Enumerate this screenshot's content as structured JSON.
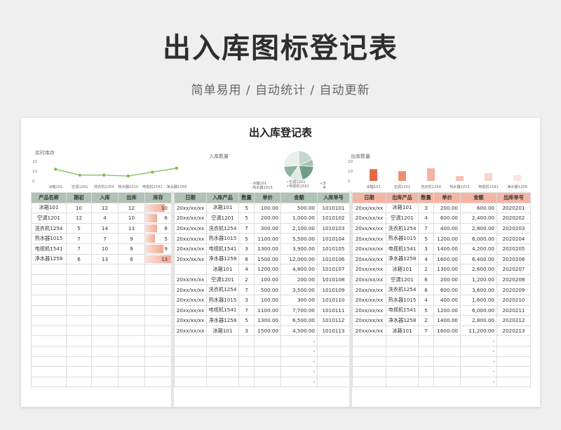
{
  "hero": {
    "title": "出入库图标登记表",
    "subtitle": "简单易用 / 自动统计 / 自动更新"
  },
  "sheet_title": "出入库登记表",
  "colors": {
    "green": "#aec3b5",
    "salmon": "#f3b6a4",
    "line": "#7cbf5a"
  },
  "charts": {
    "stock": {
      "label": "实时库存",
      "type": "line",
      "categories": [
        "冰箱101",
        "空调1201",
        "洗衣机1254",
        "热水器1015",
        "电视机1541",
        "净水器1258"
      ],
      "values": [
        12,
        6,
        6,
        5,
        9,
        13
      ],
      "yticks": [
        "20",
        "10",
        "0"
      ],
      "ylim": [
        0,
        20
      ]
    },
    "inbound": {
      "label": "入库数量",
      "type": "pie",
      "categories": [
        "冰箱101",
        "空调1201",
        "洗衣机1254",
        "热水器1015",
        "电视机1541",
        "净水器1258"
      ],
      "values": [
        9,
        4,
        10,
        7,
        7,
        13
      ],
      "colors": [
        "#c5d6cc",
        "#a9c1b3",
        "#6f9e88",
        "#dfe8e2",
        "#8fb09f",
        "#e9f0ec"
      ]
    },
    "outbound": {
      "label": "出库数量",
      "type": "bar",
      "categories": [
        "冰箱101",
        "空调1201",
        "洗衣机1254",
        "热水器1015",
        "电视机1541",
        "净水器1258"
      ],
      "values": [
        12,
        10,
        13,
        5,
        8,
        6
      ],
      "yticks": [
        "20",
        "10",
        "0"
      ],
      "ylim": [
        0,
        20
      ],
      "colors": [
        "#e26a4c",
        "#ec8f78",
        "#f2b3a3",
        "#f5c3b6",
        "#f8d4cb",
        "#fbe4de"
      ]
    }
  },
  "summary": {
    "headers": [
      "产品名称",
      "期初",
      "入库",
      "出库",
      "库存"
    ],
    "rows": [
      [
        "冰箱101",
        "10",
        "12",
        "12",
        "10"
      ],
      [
        "空调1201",
        "12",
        "4",
        "10",
        "6"
      ],
      [
        "洗衣机1254",
        "5",
        "14",
        "13",
        "6"
      ],
      [
        "热水器1015",
        "7",
        "7",
        "9",
        "5"
      ],
      [
        "电视机1541",
        "7",
        "10",
        "8",
        "9"
      ],
      [
        "净水器1258",
        "6",
        "13",
        "6",
        "13"
      ]
    ],
    "stock_levels": [
      10,
      6,
      6,
      5,
      9,
      13
    ],
    "stock_max": 13
  },
  "inbound_table": {
    "headers": [
      "日期",
      "入库产品",
      "数量",
      "单价",
      "金额",
      "入库单号"
    ],
    "rows": [
      [
        "20xx/xx/xx",
        "冰箱101",
        "5",
        "100.00",
        "500.00",
        "1010101"
      ],
      [
        "20xx/xx/xx",
        "空调1201",
        "5",
        "200.00",
        "1,000.00",
        "1010102"
      ],
      [
        "20xx/xx/xx",
        "洗衣机1254",
        "7",
        "300.00",
        "2,100.00",
        "1010103"
      ],
      [
        "20xx/xx/xx",
        "热水器1015",
        "5",
        "1100.00",
        "5,500.00",
        "1010104"
      ],
      [
        "20xx/xx/xx",
        "电视机1541",
        "3",
        "1300.00",
        "3,900.00",
        "1010105"
      ],
      [
        "20xx/xx/xx",
        "净水器1258",
        "8",
        "1500.00",
        "12,000.00",
        "1010106"
      ],
      [
        "",
        "冰箱101",
        "4",
        "1200.00",
        "4,800.00",
        "1010107"
      ],
      [
        "20xx/xx/xx",
        "空调1201",
        "2",
        "100.00",
        "200.00",
        "1010108"
      ],
      [
        "20xx/xx/xx",
        "洗衣机1254",
        "7",
        "500.00",
        "3,500.00",
        "1010109"
      ],
      [
        "20xx/xx/xx",
        "热水器1015",
        "3",
        "100.00",
        "300.00",
        "1010110"
      ],
      [
        "20xx/xx/xx",
        "电视机1541",
        "7",
        "1100.00",
        "7,700.00",
        "1010111"
      ],
      [
        "20xx/xx/xx",
        "净水器1258",
        "5",
        "1300.00",
        "6,500.00",
        "1010112"
      ],
      [
        "20xx/xx/xx",
        "冰箱101",
        "3",
        "1500.00",
        "4,500.00",
        "1010113"
      ]
    ],
    "empty_amount": "-"
  },
  "outbound_table": {
    "headers": [
      "日期",
      "出库产品",
      "数量",
      "单价",
      "金额",
      "出库单号"
    ],
    "rows": [
      [
        "20xx/xx/xx",
        "冰箱101",
        "3",
        "200.00",
        "600.00",
        "2020201"
      ],
      [
        "20xx/xx/xx",
        "空调1201",
        "4",
        "600.00",
        "2,400.00",
        "2020202"
      ],
      [
        "20xx/xx/xx",
        "洗衣机1254",
        "7",
        "400.00",
        "2,800.00",
        "2020203"
      ],
      [
        "20xx/xx/xx",
        "热水器1015",
        "5",
        "1200.00",
        "6,000.00",
        "2020204"
      ],
      [
        "20xx/xx/xx",
        "电视机1541",
        "3",
        "1400.00",
        "4,200.00",
        "2020205"
      ],
      [
        "20xx/xx/xx",
        "净水器1258",
        "4",
        "1600.00",
        "6,400.00",
        "2020206"
      ],
      [
        "20xx/xx/xx",
        "冰箱101",
        "2",
        "1300.00",
        "2,600.00",
        "2020207"
      ],
      [
        "20xx/xx/xx",
        "空调1201",
        "6",
        "200.00",
        "1,200.00",
        "2020208"
      ],
      [
        "20xx/xx/xx",
        "洗衣机1254",
        "6",
        "600.00",
        "3,600.00",
        "2020209"
      ],
      [
        "20xx/xx/xx",
        "热水器1015",
        "4",
        "400.00",
        "1,600.00",
        "2020210"
      ],
      [
        "20xx/xx/xx",
        "电视机1541",
        "5",
        "1200.00",
        "6,000.00",
        "2020211"
      ],
      [
        "20xx/xx/xx",
        "净水器1258",
        "2",
        "1400.00",
        "2,800.00",
        "2020212"
      ],
      [
        "20xx/xx/xx",
        "冰箱101",
        "7",
        "1600.00",
        "11,200.00",
        "2020213"
      ]
    ],
    "empty_amount": "-"
  }
}
